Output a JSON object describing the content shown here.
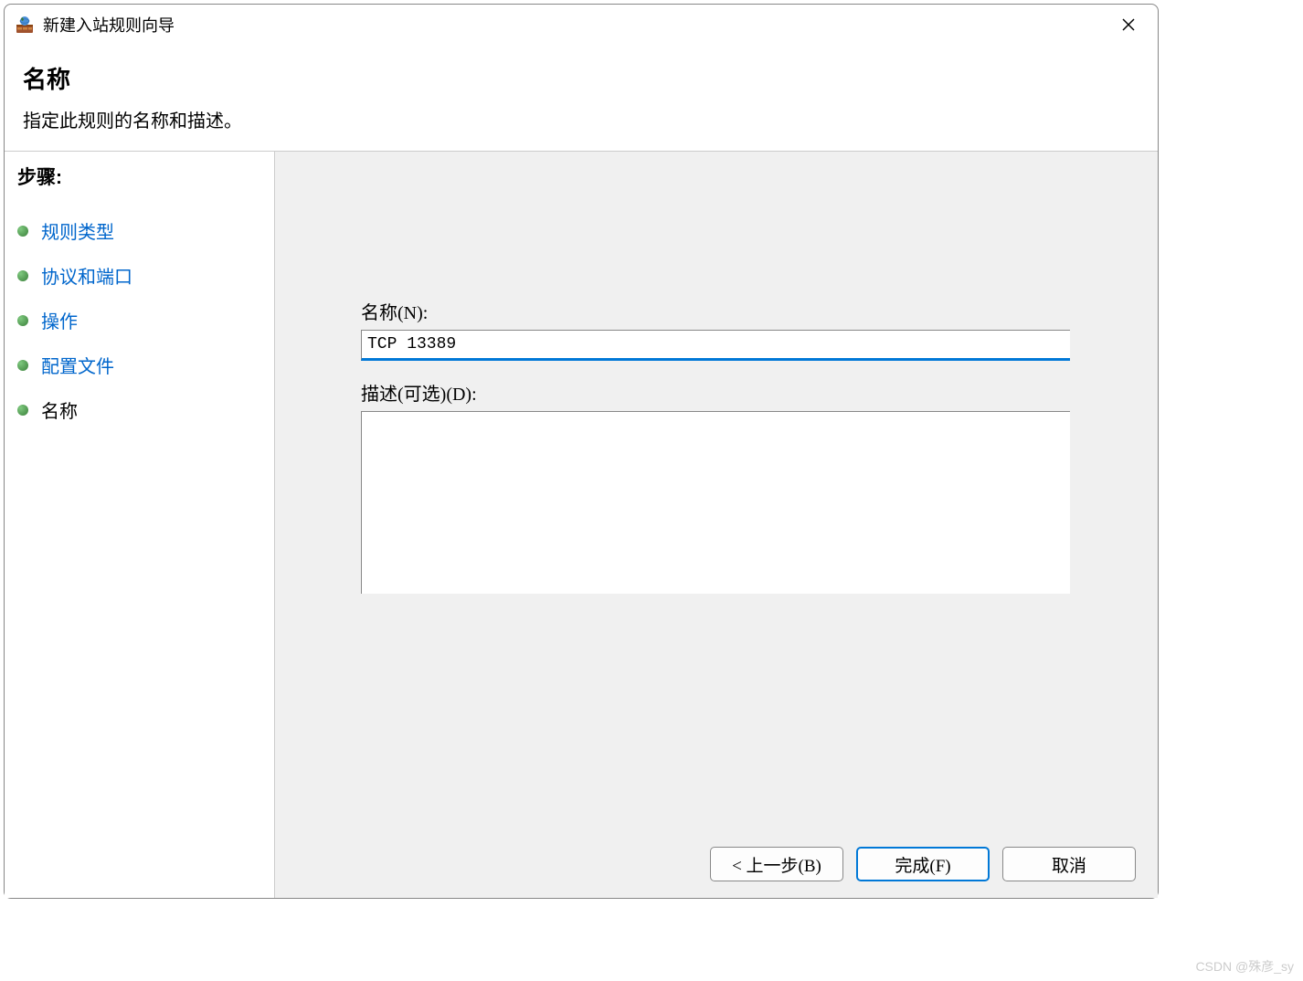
{
  "titlebar": {
    "title": "新建入站规则向导"
  },
  "header": {
    "title": "名称",
    "subtitle": "指定此规则的名称和描述。"
  },
  "sidebar": {
    "steps_header": "步骤:",
    "items": [
      {
        "label": "规则类型",
        "current": false
      },
      {
        "label": "协议和端口",
        "current": false
      },
      {
        "label": "操作",
        "current": false
      },
      {
        "label": "配置文件",
        "current": false
      },
      {
        "label": "名称",
        "current": true
      }
    ]
  },
  "form": {
    "name_label": "名称(N):",
    "name_value": "TCP 13389",
    "desc_label": "描述(可选)(D):",
    "desc_value": ""
  },
  "buttons": {
    "back": "< 上一步(B)",
    "finish": "完成(F)",
    "cancel": "取消"
  },
  "watermark": "CSDN @殊彦_sy"
}
